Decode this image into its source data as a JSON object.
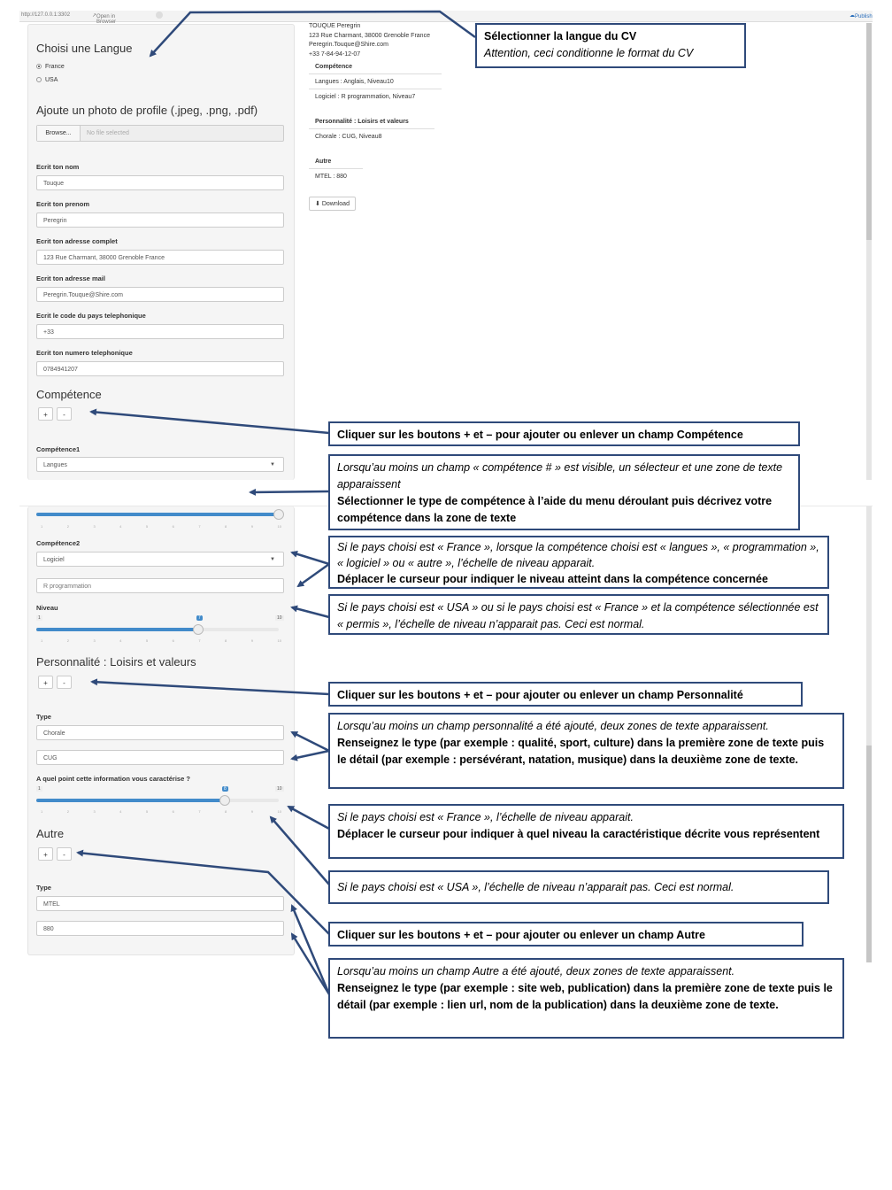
{
  "browser": {
    "url": "http://127.0.0.1:3302",
    "open_in_browser": "Open in Browser",
    "publish": "Publish"
  },
  "form": {
    "language_title": "Choisi une Langue",
    "languages": [
      "France",
      "USA"
    ],
    "photo_title": "Ajoute un photo de profile (.jpeg, .png, .pdf)",
    "browse_label": "Browse...",
    "no_file": "No file selected",
    "fields": [
      {
        "label": "Ecrit ton nom",
        "value": "Touque"
      },
      {
        "label": "Ecrit ton prenom",
        "value": "Peregrin"
      },
      {
        "label": "Ecrit ton adresse complet",
        "value": "123 Rue Charmant, 38000 Grenoble France"
      },
      {
        "label": "Ecrit ton adresse mail",
        "value": "Peregrin.Touque@Shire.com"
      },
      {
        "label": "Ecrit le code du pays telephonique",
        "value": "+33"
      },
      {
        "label": "Ecrit ton numero telephonique",
        "value": "0784941207"
      }
    ],
    "competence_title": "Compétence",
    "plus": "+",
    "minus": "-",
    "competence1_label": "Compétence1",
    "competence1_value": "Langues",
    "competence2_label": "Compétence2",
    "competence2_value": "Logiciel",
    "competence2_text": "R programmation",
    "niveau_label": "Niveau",
    "slider_min": "1",
    "slider_max": "10",
    "niveau_value": "7",
    "niveau_fraction": 0.667,
    "personality_title": "Personnalité : Loisirs et valeurs",
    "type_label": "Type",
    "personality_type": "Chorale",
    "personality_detail": "CUG",
    "personality_question": "A quel point cette information vous caractérise ?",
    "personality_value": "8",
    "personality_fraction": 0.778,
    "autre_title": "Autre",
    "autre_type": "MTEL",
    "autre_detail": "880"
  },
  "preview": {
    "header_lines": [
      "TOUQUE Peregrin",
      "123 Rue Charmant, 38000 Grenoble France",
      "Peregrin.Touque@Shire.com",
      "+33 7-84-94-12-07"
    ],
    "competence_title": "Compétence",
    "competence_items": [
      "Langues : Anglais, Niveau10",
      "Logiciel : R programmation, Niveau7"
    ],
    "personality_title": "Personnalité : Loisirs et valeurs",
    "personality_items": [
      "Chorale : CUG, Niveau8"
    ],
    "autre_title": "Autre",
    "autre_items": [
      "MTEL : 880"
    ],
    "download": "Download"
  },
  "annotations": [
    {
      "bold": "Sélectionner la langue du CV",
      "italic": "Attention, ceci conditionne le format du CV"
    },
    {
      "bold": "Cliquer sur les boutons + et – pour ajouter ou enlever un champ Compétence"
    },
    {
      "italic": "Lorsqu’au moins un champ « compétence # » est visible, un sélecteur et une zone de texte apparaissent",
      "bold": "Sélectionner le type de compétence à l’aide du menu déroulant puis décrivez votre compétence dans la zone de texte"
    },
    {
      "italic": "Si le pays choisi est « France », lorsque la compétence choisi est « langues », « programmation », « logiciel » ou « autre », l’échelle de niveau apparait.",
      "bold": "Déplacer le curseur pour indiquer le niveau atteint dans la compétence concernée"
    },
    {
      "italic": "Si le pays choisi est « USA » ou si le pays choisi est « France » et la compétence sélectionnée est « permis », l’échelle de niveau n’apparait pas. Ceci est normal."
    },
    {
      "bold": "Cliquer sur les boutons + et – pour ajouter ou enlever un champ Personnalité"
    },
    {
      "italic": "Lorsqu’au moins un champ personnalité a été ajouté, deux zones de texte apparaissent.",
      "bold": "Renseignez le type (par exemple : qualité, sport, culture) dans la première zone de texte puis le détail (par exemple : persévérant, natation, musique) dans la deuxième zone de texte."
    },
    {
      "italic": "Si le pays choisi est « France », l’échelle de niveau apparait.",
      "bold": "Déplacer le curseur pour indiquer à quel niveau la caractéristique décrite vous représentent"
    },
    {
      "italic": "Si le pays choisi est « USA », l’échelle de niveau n’apparait pas. Ceci est normal."
    },
    {
      "bold": "Cliquer sur les boutons + et – pour ajouter ou enlever un champ Autre"
    },
    {
      "italic": "Lorsqu’au moins un champ Autre a été ajouté, deux zones de texte apparaissent.",
      "bold": "Renseignez le type (par exemple : site web, publication) dans la première zone de texte puis le détail (par exemple : lien url, nom de la publication) dans la deuxième zone de texte."
    }
  ],
  "colors": {
    "arrow": "#2f4a7a",
    "slider": "#428bca"
  }
}
